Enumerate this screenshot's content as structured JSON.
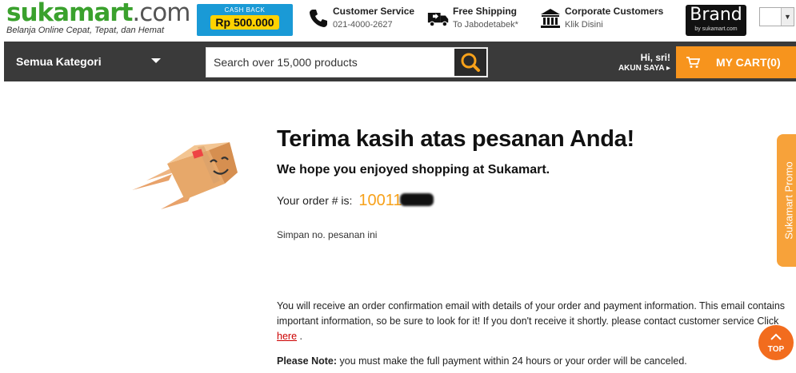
{
  "header": {
    "logo": {
      "part1": "suka",
      "part2": "mart",
      "part3": ".com",
      "tagline": "Belanja Online Cepat, Tepat, dan Hemat"
    },
    "cashback": {
      "label": "CASH BACK",
      "amount": "Rp 500.000"
    },
    "customer_service": {
      "title": "Customer Service",
      "subtitle": "021-4000-2627",
      "icon": "phone-icon"
    },
    "free_shipping": {
      "title": "Free Shipping",
      "subtitle": "To Jabodetabek*",
      "icon": "truck-icon"
    },
    "corporate": {
      "title": "Corporate Customers",
      "subtitle": "Klik Disini",
      "icon": "building-icon"
    },
    "brand": {
      "line1": "Brand",
      "line2": "by sukamart.com"
    }
  },
  "nav": {
    "category_label": "Semua Kategori",
    "search_placeholder": "Search over 15,000 products",
    "greeting": "Hi, sri!",
    "account_label": "AKUN SAYA",
    "cart_label": "MY CART(0)"
  },
  "main": {
    "thanks_title": "Terima kasih atas pesanan Anda!",
    "hope_text": "We hope you enjoyed shopping at Sukamart.",
    "order_label": "Your order # is:",
    "order_number_visible": "10011",
    "save_note": "Simpan no. pesanan ini",
    "confirm_text": "You will receive an order confirmation email with details of your order and payment information. This email contains important information, so be sure to look for it! If you don't receive it shortly. please contact customer service Click ",
    "here_link": "here",
    "confirm_tail": " .",
    "note_label": "Please Note:",
    "note_text": " you must make the full payment within 24 hours or your order will be canceled."
  },
  "side": {
    "promo_label": "Sukamart Promo",
    "top_label": "TOP"
  },
  "colors": {
    "brand_green": "#3aa12d",
    "nav_dark": "#3a3a3a",
    "cart_orange": "#f7941d",
    "order_number": "#f7a11a",
    "link_red": "#cc0000"
  }
}
